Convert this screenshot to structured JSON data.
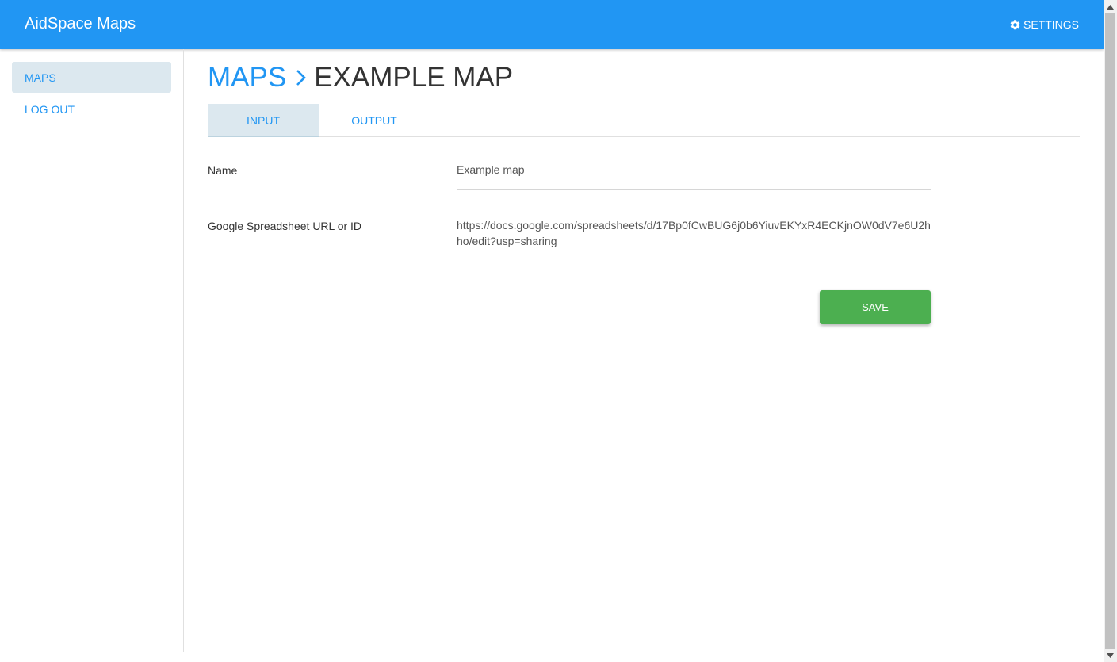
{
  "app": {
    "title": "AidSpace Maps"
  },
  "header": {
    "settings_label": "SETTINGS",
    "settings_icon": "gear-icon"
  },
  "sidebar": {
    "items": [
      {
        "label": "MAPS",
        "active": true
      },
      {
        "label": "LOG OUT",
        "active": false
      }
    ]
  },
  "breadcrumb": {
    "parent": "MAPS",
    "current": "EXAMPLE MAP",
    "separator_icon": "chevron-right-icon"
  },
  "tabs": [
    {
      "label": "INPUT",
      "active": true
    },
    {
      "label": "OUTPUT",
      "active": false
    }
  ],
  "form": {
    "name": {
      "label": "Name",
      "value": "Example map"
    },
    "spreadsheet": {
      "label": "Google Spreadsheet URL or ID",
      "value": "https://docs.google.com/spreadsheets/d/17Bp0fCwBUG6j0b6YiuvEKYxR4ECKjnOW0dV7e6U2hho/edit?usp=sharing"
    },
    "save_label": "SAVE"
  },
  "colors": {
    "primary": "#2196f3",
    "save": "#4caf50",
    "active_bg": "#dce8ef"
  }
}
